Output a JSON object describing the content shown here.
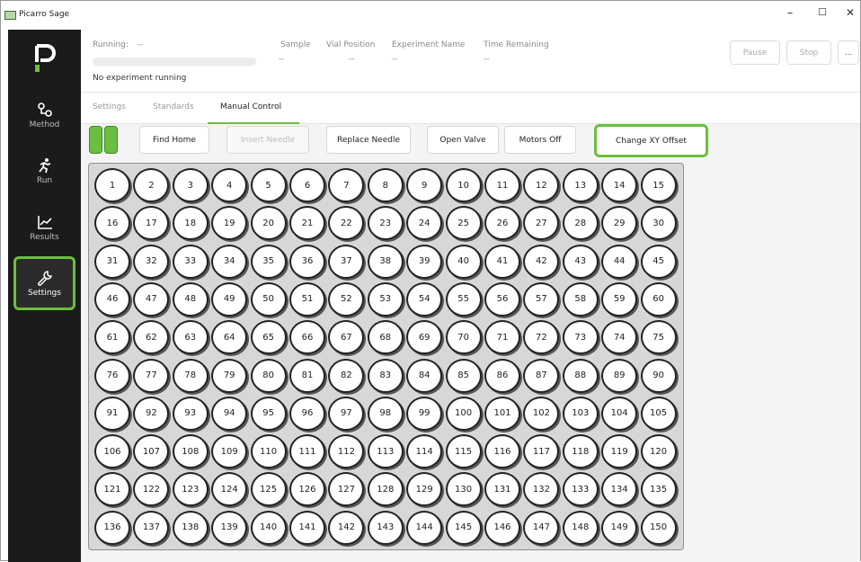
{
  "window": {
    "title": "Picarro Sage",
    "minimize": "–",
    "maximize": "☐",
    "close": "✕"
  },
  "sidebar": {
    "items": [
      {
        "label": "Method",
        "icon": "method-icon"
      },
      {
        "label": "Run",
        "icon": "run-icon"
      },
      {
        "label": "Results",
        "icon": "chart-icon"
      },
      {
        "label": "Settings",
        "icon": "wrench-icon",
        "active": true
      }
    ]
  },
  "header": {
    "running_label": "Running:",
    "running_value": "--",
    "sample_label": "Sample",
    "sample_value": "--",
    "vial_label": "Vial Position",
    "vial_value": "--",
    "experiment_label": "Experiment Name",
    "experiment_value": "--",
    "time_label": "Time Remaining",
    "time_value": "--",
    "status": "No experiment running",
    "pause_label": "Pause",
    "stop_label": "Stop",
    "more_label": "..."
  },
  "tabs": [
    {
      "label": "Settings"
    },
    {
      "label": "Standards"
    },
    {
      "label": "Manual Control",
      "active": true
    }
  ],
  "controls": {
    "find_home": "Find Home",
    "insert_needle": "Insert Needle",
    "replace_needle": "Replace Needle",
    "open_valve": "Open Valve",
    "motors_off": "Motors Off",
    "change_xy_offset": "Change XY Offset"
  },
  "tray": {
    "rows": 10,
    "columns": 15,
    "vials": [
      "1",
      "2",
      "3",
      "4",
      "5",
      "6",
      "7",
      "8",
      "9",
      "10",
      "11",
      "12",
      "13",
      "14",
      "15",
      "16",
      "17",
      "18",
      "19",
      "20",
      "21",
      "22",
      "23",
      "24",
      "25",
      "26",
      "27",
      "28",
      "29",
      "30",
      "31",
      "32",
      "33",
      "34",
      "35",
      "36",
      "37",
      "38",
      "39",
      "40",
      "41",
      "42",
      "43",
      "44",
      "45",
      "46",
      "47",
      "48",
      "49",
      "50",
      "51",
      "52",
      "53",
      "54",
      "55",
      "56",
      "57",
      "58",
      "59",
      "60",
      "61",
      "62",
      "63",
      "64",
      "65",
      "66",
      "67",
      "68",
      "69",
      "70",
      "71",
      "72",
      "73",
      "74",
      "75",
      "76",
      "77",
      "78",
      "79",
      "80",
      "81",
      "82",
      "83",
      "84",
      "85",
      "86",
      "87",
      "88",
      "89",
      "90",
      "91",
      "92",
      "93",
      "94",
      "95",
      "96",
      "97",
      "98",
      "99",
      "100",
      "101",
      "102",
      "103",
      "104",
      "105",
      "106",
      "107",
      "108",
      "109",
      "110",
      "111",
      "112",
      "113",
      "114",
      "115",
      "116",
      "117",
      "118",
      "119",
      "120",
      "121",
      "122",
      "123",
      "124",
      "125",
      "126",
      "127",
      "128",
      "129",
      "130",
      "131",
      "132",
      "133",
      "134",
      "135",
      "136",
      "137",
      "138",
      "139",
      "140",
      "141",
      "142",
      "143",
      "144",
      "145",
      "146",
      "147",
      "148",
      "149",
      "150"
    ]
  },
  "colors": {
    "accent": "#6abf3e",
    "sidebar_bg": "#1b1b1b",
    "tray_bg": "#d7d7d7"
  }
}
